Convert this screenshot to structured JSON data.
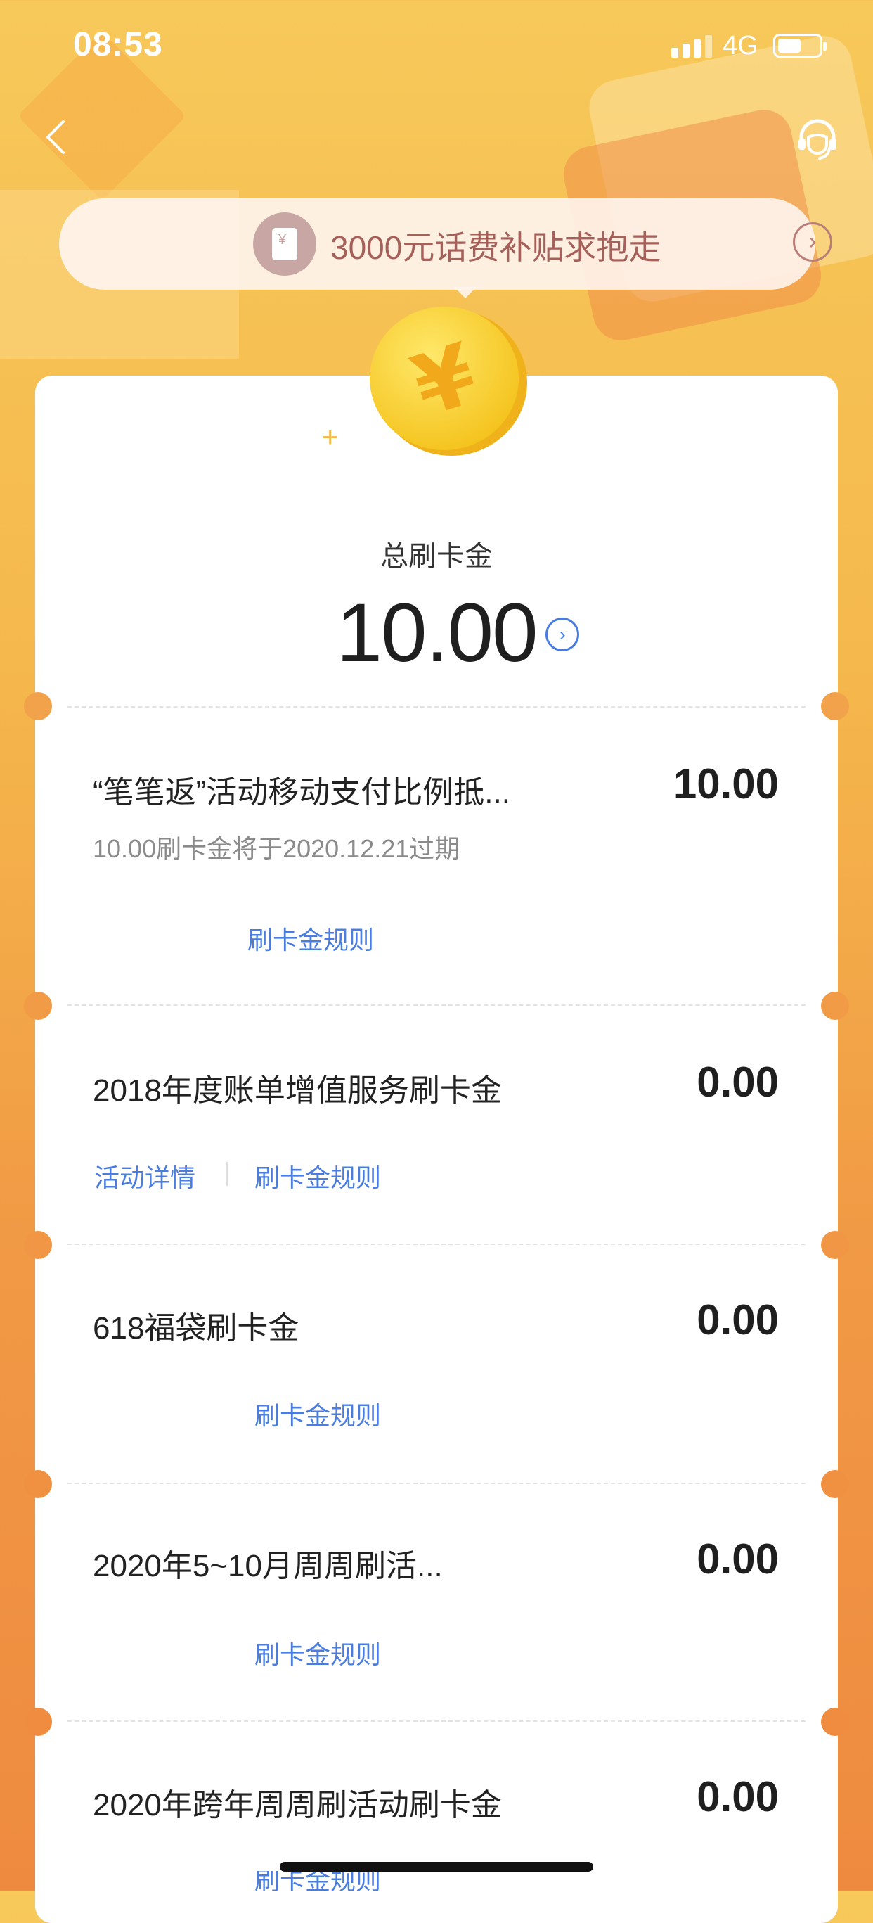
{
  "status_bar": {
    "time": "08:53",
    "network": "4G"
  },
  "banner": {
    "text": "3000元话费补贴求抱走"
  },
  "summary": {
    "label": "总刷卡金",
    "total": "10.00"
  },
  "items": [
    {
      "title": "“笔笔返”活动移动支付比例抵...",
      "amount": "10.00",
      "subtitle": "10.00刷卡金将于2020.12.21过期",
      "links": [
        "刷卡金规则"
      ]
    },
    {
      "title": "2018年度账单增值服务刷卡金",
      "amount": "0.00",
      "links": [
        "活动详情",
        "刷卡金规则"
      ]
    },
    {
      "title": "618福袋刷卡金",
      "amount": "0.00",
      "links": [
        "刷卡金规则"
      ]
    },
    {
      "title": "2020年5~10月周周刷活...",
      "amount": "0.00",
      "links": [
        "刷卡金规则"
      ]
    },
    {
      "title": "2020年跨年周周刷活动刷卡金",
      "amount": "0.00",
      "links": [
        "刷卡金规则"
      ]
    }
  ],
  "colors": {
    "accent_link": "#4a7de2",
    "background_top": "#f7c95a",
    "background_bottom": "#ee8a3f",
    "banner_text": "#a6605a"
  }
}
